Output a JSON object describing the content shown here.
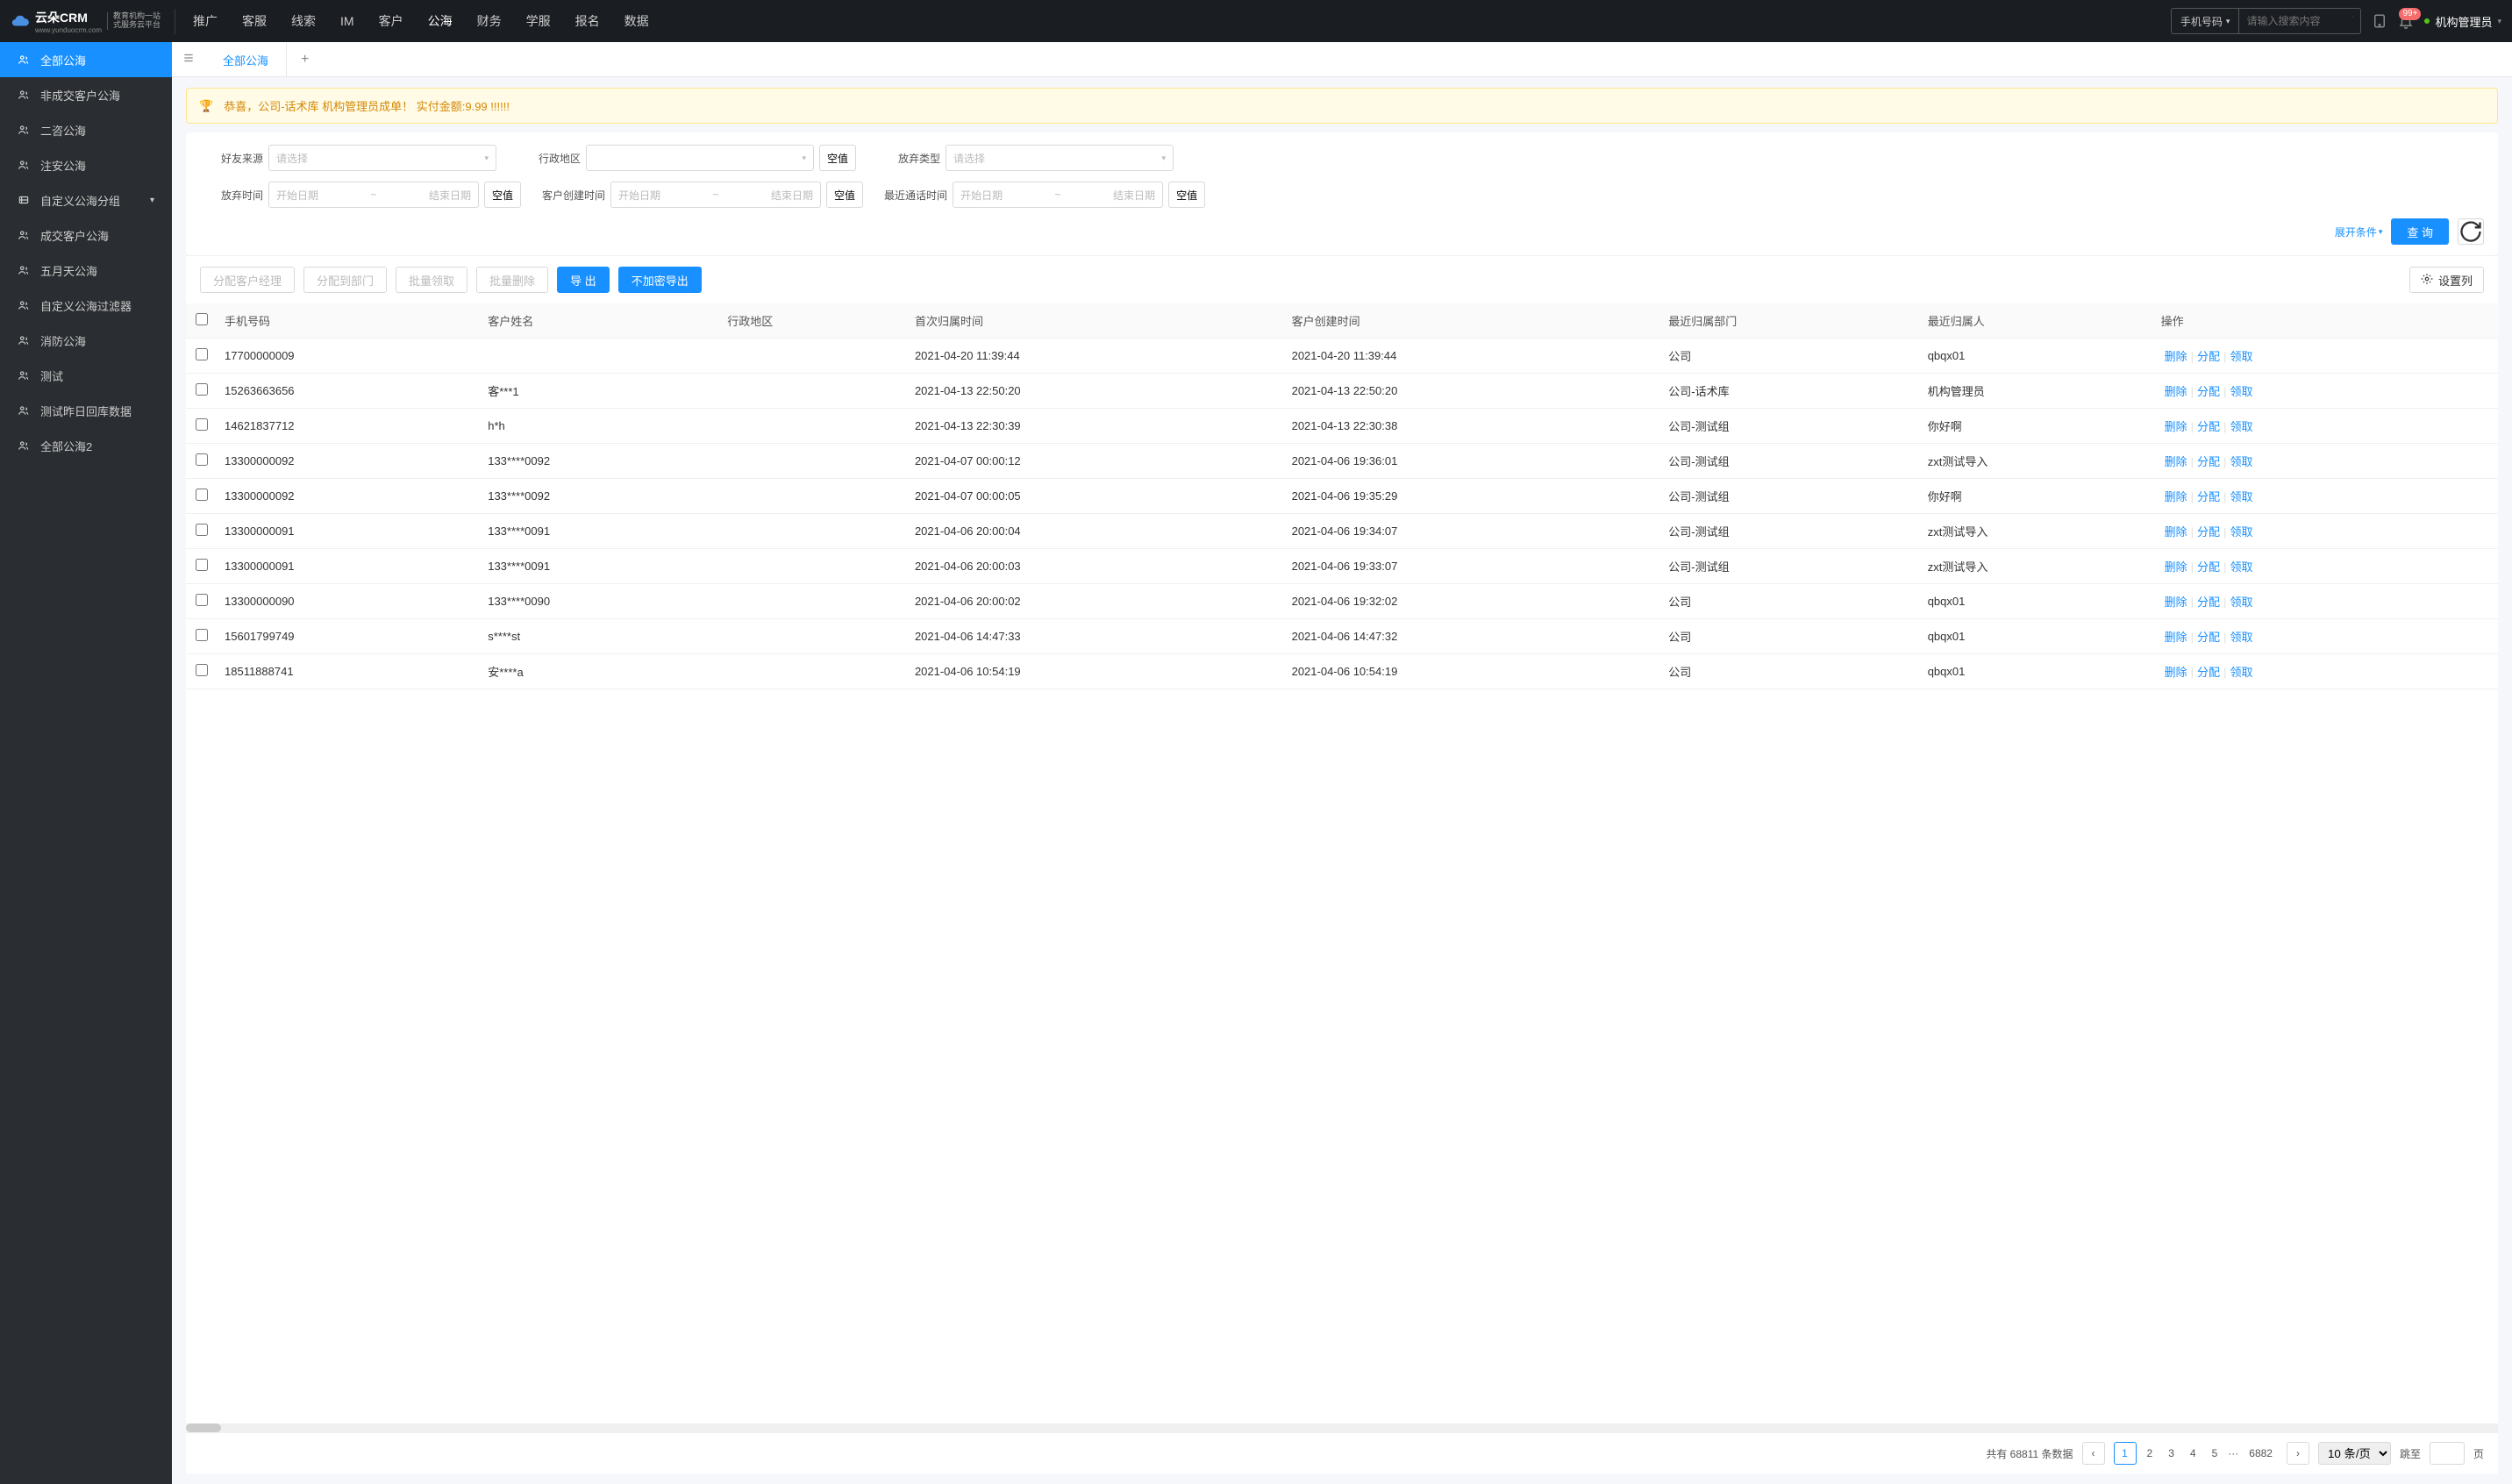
{
  "header": {
    "logo_main": "云朵CRM",
    "logo_url": "www.yunduocrm.com",
    "logo_sub1": "教育机构一站",
    "logo_sub2": "式服务云平台",
    "nav": [
      "推广",
      "客服",
      "线索",
      "IM",
      "客户",
      "公海",
      "财务",
      "学服",
      "报名",
      "数据"
    ],
    "nav_active": 5,
    "search_type": "手机号码",
    "search_placeholder": "请输入搜索内容",
    "badge": "99+",
    "user": "机构管理员"
  },
  "sidebar": [
    {
      "label": "全部公海",
      "icon": "users",
      "active": true
    },
    {
      "label": "非成交客户公海",
      "icon": "users"
    },
    {
      "label": "二咨公海",
      "icon": "users"
    },
    {
      "label": "注安公海",
      "icon": "users"
    },
    {
      "label": "自定义公海分组",
      "icon": "folder",
      "chevron": true
    },
    {
      "label": "成交客户公海",
      "icon": "users"
    },
    {
      "label": "五月天公海",
      "icon": "users"
    },
    {
      "label": "自定义公海过滤器",
      "icon": "users"
    },
    {
      "label": "消防公海",
      "icon": "users"
    },
    {
      "label": "测试",
      "icon": "users"
    },
    {
      "label": "测试昨日回库数据",
      "icon": "users"
    },
    {
      "label": "全部公海2",
      "icon": "users"
    }
  ],
  "tabs": {
    "active": "全部公海"
  },
  "banner": "恭喜，公司-话术库  机构管理员成单！  实付金额:9.99 !!!!!!",
  "filters": {
    "row1": [
      {
        "label": "好友来源",
        "type": "select",
        "placeholder": "请选择"
      },
      {
        "label": "行政地区",
        "type": "select",
        "placeholder": "",
        "empty": true
      },
      {
        "label": "放弃类型",
        "type": "select",
        "placeholder": "请选择"
      }
    ],
    "row2": [
      {
        "label": "放弃时间",
        "type": "date",
        "start": "开始日期",
        "end": "结束日期",
        "empty": true
      },
      {
        "label": "客户创建时间",
        "type": "date",
        "start": "开始日期",
        "end": "结束日期",
        "empty": true
      },
      {
        "label": "最近通话时间",
        "type": "date",
        "start": "开始日期",
        "end": "结束日期",
        "empty": true
      }
    ],
    "expand": "展开条件",
    "search_btn": "查 询",
    "empty_label": "空值"
  },
  "toolbar": {
    "buttons": [
      {
        "label": "分配客户经理",
        "disabled": true
      },
      {
        "label": "分配到部门",
        "disabled": true
      },
      {
        "label": "批量领取",
        "disabled": true
      },
      {
        "label": "批量删除",
        "disabled": true
      },
      {
        "label": "导 出",
        "primary": true
      },
      {
        "label": "不加密导出",
        "primary": true
      }
    ],
    "config": "设置列"
  },
  "table": {
    "headers": [
      "手机号码",
      "客户姓名",
      "行政地区",
      "首次归属时间",
      "客户创建时间",
      "最近归属部门",
      "最近归属人",
      "操作"
    ],
    "ops": [
      "删除",
      "分配",
      "领取"
    ],
    "rows": [
      {
        "phone": "17700000009",
        "name": "",
        "region": "",
        "first_time": "2021-04-20 11:39:44",
        "create_time": "2021-04-20 11:39:44",
        "dept": "公司",
        "owner": "qbqx01"
      },
      {
        "phone": "15263663656",
        "name": "客***1",
        "region": "",
        "first_time": "2021-04-13 22:50:20",
        "create_time": "2021-04-13 22:50:20",
        "dept": "公司-话术库",
        "owner": "机构管理员"
      },
      {
        "phone": "14621837712",
        "name": "h*h",
        "region": "",
        "first_time": "2021-04-13 22:30:39",
        "create_time": "2021-04-13 22:30:38",
        "dept": "公司-测试组",
        "owner": "你好啊"
      },
      {
        "phone": "13300000092",
        "name": "133****0092",
        "region": "",
        "first_time": "2021-04-07 00:00:12",
        "create_time": "2021-04-06 19:36:01",
        "dept": "公司-测试组",
        "owner": "zxt测试导入"
      },
      {
        "phone": "13300000092",
        "name": "133****0092",
        "region": "",
        "first_time": "2021-04-07 00:00:05",
        "create_time": "2021-04-06 19:35:29",
        "dept": "公司-测试组",
        "owner": "你好啊"
      },
      {
        "phone": "13300000091",
        "name": "133****0091",
        "region": "",
        "first_time": "2021-04-06 20:00:04",
        "create_time": "2021-04-06 19:34:07",
        "dept": "公司-测试组",
        "owner": "zxt测试导入"
      },
      {
        "phone": "13300000091",
        "name": "133****0091",
        "region": "",
        "first_time": "2021-04-06 20:00:03",
        "create_time": "2021-04-06 19:33:07",
        "dept": "公司-测试组",
        "owner": "zxt测试导入"
      },
      {
        "phone": "13300000090",
        "name": "133****0090",
        "region": "",
        "first_time": "2021-04-06 20:00:02",
        "create_time": "2021-04-06 19:32:02",
        "dept": "公司",
        "owner": "qbqx01"
      },
      {
        "phone": "15601799749",
        "name": "s****st",
        "region": "",
        "first_time": "2021-04-06 14:47:33",
        "create_time": "2021-04-06 14:47:32",
        "dept": "公司",
        "owner": "qbqx01"
      },
      {
        "phone": "18511888741",
        "name": "安****a",
        "region": "",
        "first_time": "2021-04-06 10:54:19",
        "create_time": "2021-04-06 10:54:19",
        "dept": "公司",
        "owner": "qbqx01"
      }
    ]
  },
  "pager": {
    "total_prefix": "共有",
    "total": "68811",
    "total_suffix": "条数据",
    "pages": [
      "1",
      "2",
      "3",
      "4",
      "5"
    ],
    "ellipsis": "···",
    "last": "6882",
    "per_page": "10 条/页",
    "jump_label": "跳至",
    "jump_suffix": "页"
  }
}
